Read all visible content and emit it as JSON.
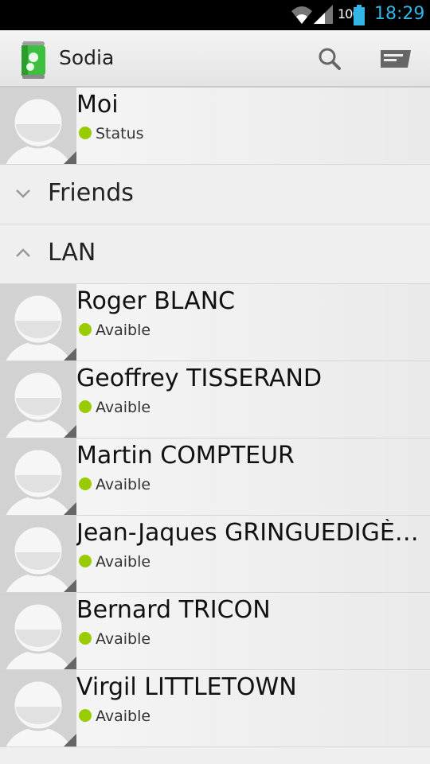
{
  "statusbar": {
    "battery": "100",
    "time": "18:29",
    "wifi_icon": "wifi-icon",
    "signal_icon": "signal-icon",
    "battery_icon": "battery-icon"
  },
  "actionbar": {
    "title": "Sodia",
    "logo_icon": "soda-can-icon",
    "search_icon": "search-icon",
    "overflow_icon": "message-icon"
  },
  "me": {
    "name": "Moi",
    "status": "Status"
  },
  "groups": [
    {
      "label": "Friends",
      "expanded": false
    },
    {
      "label": "LAN",
      "expanded": true
    }
  ],
  "contacts": [
    {
      "name": "Roger BLANC",
      "status": "Avaible"
    },
    {
      "name": "Geoffrey TISSERAND",
      "status": "Avaible"
    },
    {
      "name": "Martin COMPTEUR",
      "status": "Avaible"
    },
    {
      "name": "Jean-Jaques GRINGUEDIGÈ…",
      "status": "Avaible"
    },
    {
      "name": "Bernard TRICON",
      "status": "Avaible"
    },
    {
      "name": "Virgil LITTLETOWN",
      "status": "Avaible"
    }
  ],
  "colors": {
    "accent": "#33b5e5",
    "presence": "#99cc00"
  }
}
